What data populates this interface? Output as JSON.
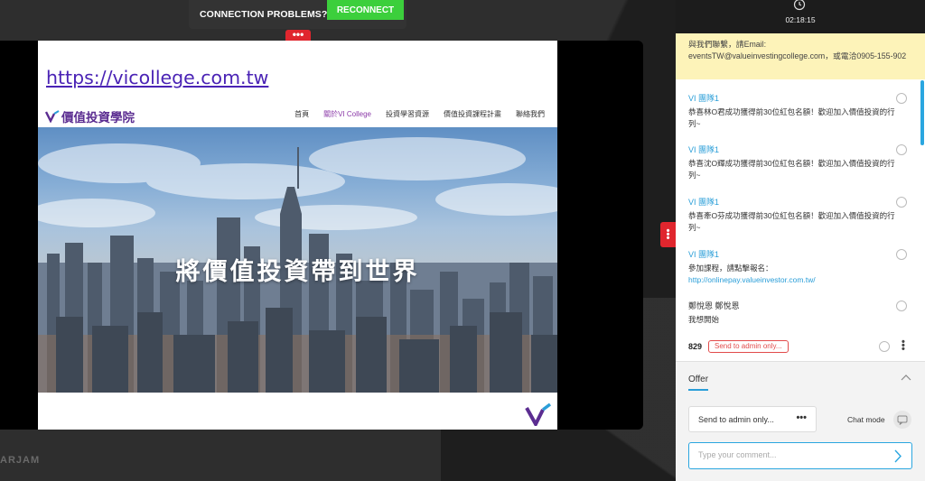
{
  "connection": {
    "message": "CONNECTION PROBLEMS?",
    "reconnect_label": "RECONNECT"
  },
  "slide": {
    "url_text": "https://vicollege.com.tw",
    "brand": "價值投資學院",
    "menu": [
      "首頁",
      "關於VI College",
      "投資學習資源",
      "價值投資課程計畫",
      "聯絡我們"
    ],
    "hero_title": "將價值投資帶到世界"
  },
  "watermark": "ARJAM",
  "panel": {
    "timer": "02:18:15",
    "notice": "與我們聯繫，請Email: eventsTW@valueinvestingcollege.com，或電洽0905-155-902",
    "messages": [
      {
        "author": "VI 團隊1",
        "text": "恭喜林O君成功獲得前30位紅包名額！歡迎加入價值投資的行列~"
      },
      {
        "author": "VI 團隊1",
        "text": "恭喜沈O輝成功獲得前30位紅包名額！歡迎加入價值投資的行列~"
      },
      {
        "author": "VI 團隊1",
        "text": "恭喜牽O芬成功獲得前30位紅包名額！歡迎加入價值投資的行列~"
      },
      {
        "author": "VI 團隊1",
        "text": "參加課程，請點擊報名：",
        "link": "http://onlinepay.valueinvestor.com.tw/"
      },
      {
        "author": "鄭悅恩 鄭悅恩",
        "text": "我想開始"
      }
    ],
    "last_row": {
      "name": "829",
      "badge": "Send to admin only..."
    },
    "offer_tab": "Offer",
    "send_select": "Send to admin only...",
    "send_select_more": "•••",
    "chat_mode_label": "Chat mode",
    "comment_placeholder": "Type your comment..."
  },
  "colors": {
    "accent": "#2a9ed8",
    "reconnect": "#3ccf3c",
    "danger": "#e0262e",
    "notice_bg": "#fdf3b9"
  }
}
